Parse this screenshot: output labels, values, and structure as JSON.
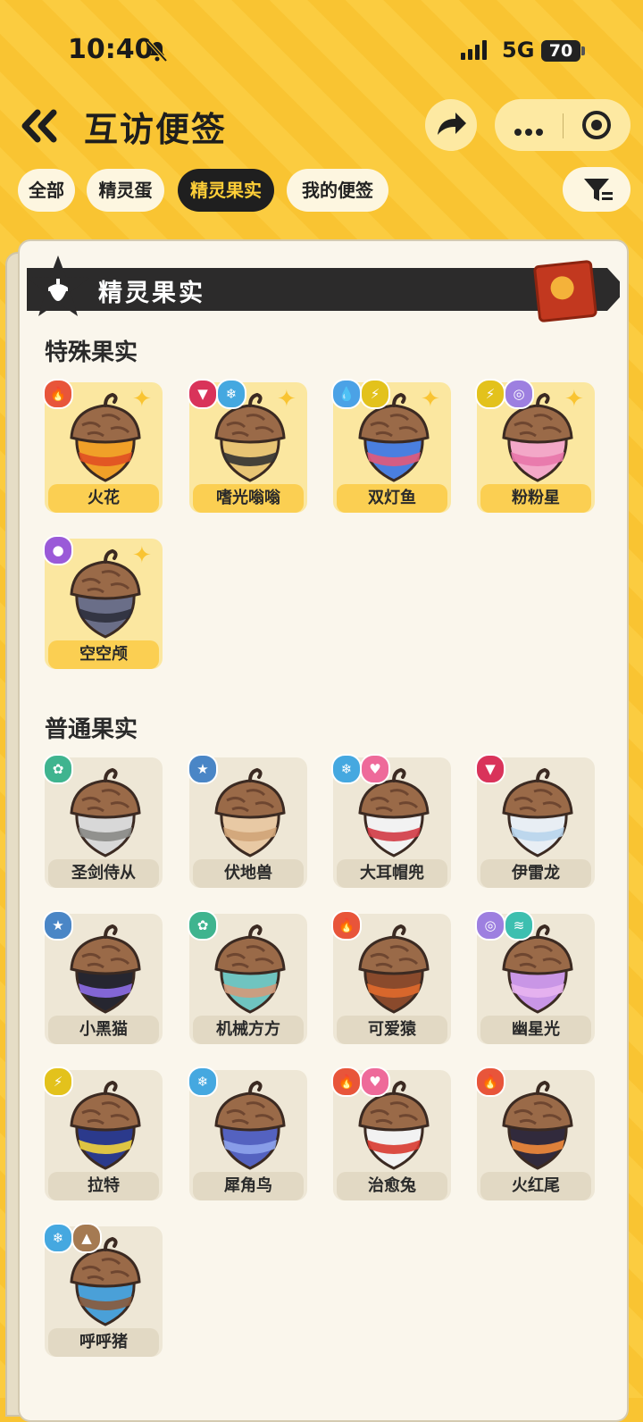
{
  "status": {
    "time": "10:40",
    "network": "5G",
    "battery": "70"
  },
  "header": {
    "title": "互访便签"
  },
  "tabs": [
    {
      "label": "全部",
      "active": false
    },
    {
      "label": "精灵蛋",
      "active": false
    },
    {
      "label": "精灵果实",
      "active": true
    },
    {
      "label": "我的便签",
      "active": false
    }
  ],
  "card": {
    "banner_title": "精灵果实"
  },
  "special": {
    "title": "特殊果实",
    "items": [
      {
        "name": "火花",
        "elements": [
          "fire"
        ]
      },
      {
        "name": "嗜光嗡嗡",
        "elements": [
          "demon",
          "ice"
        ]
      },
      {
        "name": "双灯鱼",
        "elements": [
          "water",
          "electric"
        ]
      },
      {
        "name": "粉粉星",
        "elements": [
          "electric",
          "illusion"
        ]
      },
      {
        "name": "空空颅",
        "elements": [
          "ghost"
        ]
      }
    ]
  },
  "normal": {
    "title": "普通果实",
    "items": [
      {
        "name": "圣剑侍从",
        "elements": [
          "grass"
        ]
      },
      {
        "name": "伏地兽",
        "elements": [
          "normal"
        ]
      },
      {
        "name": "大耳帽兜",
        "elements": [
          "ice",
          "cute"
        ]
      },
      {
        "name": "伊雷龙",
        "elements": [
          "demon"
        ]
      },
      {
        "name": "小黑猫",
        "elements": [
          "normal"
        ]
      },
      {
        "name": "机械方方",
        "elements": [
          "grass"
        ]
      },
      {
        "name": "可爱猿",
        "elements": [
          "fire"
        ]
      },
      {
        "name": "幽星光",
        "elements": [
          "illusion",
          "wind"
        ]
      },
      {
        "name": "拉特",
        "elements": [
          "electric"
        ]
      },
      {
        "name": "犀角鸟",
        "elements": [
          "ice"
        ]
      },
      {
        "name": "治愈兔",
        "elements": [
          "fire",
          "cute"
        ]
      },
      {
        "name": "火红尾",
        "elements": [
          "fire"
        ]
      },
      {
        "name": "呼呼猪",
        "elements": [
          "ice",
          "earth"
        ]
      }
    ]
  },
  "element_colors": {
    "fire": "#e8553a",
    "demon": "#d9335a",
    "ice": "#45a8e0",
    "water": "#4ba2e6",
    "electric": "#e3c21c",
    "illusion": "#9d7fe0",
    "ghost": "#9a5ad8",
    "grass": "#3fb48f",
    "normal": "#4a86c6",
    "cute": "#ee6a9a",
    "wind": "#3dbfb0",
    "earth": "#a57a52"
  },
  "element_glyphs": {
    "fire": "🔥",
    "demon": "▼",
    "ice": "❄",
    "water": "💧",
    "electric": "⚡",
    "illusion": "◎",
    "ghost": "●",
    "grass": "✿",
    "normal": "★",
    "cute": "♥",
    "wind": "≋",
    "earth": "▲"
  },
  "acorn_colors": {
    "火花": [
      "#f0a028",
      "#e04f22"
    ],
    "嗜光嗡嗡": [
      "#e8c474",
      "#333333"
    ],
    "双灯鱼": [
      "#4a7fe0",
      "#e25a7a"
    ],
    "粉粉星": [
      "#f3a8c8",
      "#e876aa"
    ],
    "空空颅": [
      "#6a6e88",
      "#2d2f3c"
    ],
    "圣剑侍从": [
      "#d8d8d8",
      "#8a8a86"
    ],
    "伏地兽": [
      "#e8c9a4",
      "#d0a478"
    ],
    "大耳帽兜": [
      "#f2f2f2",
      "#d23a44"
    ],
    "伊雷龙": [
      "#e8eef4",
      "#b8d4ec"
    ],
    "小黑猫": [
      "#262630",
      "#8e6ee8"
    ],
    "机械方方": [
      "#6fc4c0",
      "#d39a7a"
    ],
    "可爱猿": [
      "#8a4a2c",
      "#e06a2c"
    ],
    "幽星光": [
      "#c996e6",
      "#e8b4f0"
    ],
    "拉特": [
      "#2b3a8c",
      "#f2d43c"
    ],
    "犀角鸟": [
      "#5462c0",
      "#8ea4ec"
    ],
    "治愈兔": [
      "#f2f2f2",
      "#d83a30"
    ],
    "火红尾": [
      "#312a3c",
      "#f28a3a"
    ],
    "呼呼猪": [
      "#4aa0d8",
      "#8a5a3c"
    ]
  }
}
